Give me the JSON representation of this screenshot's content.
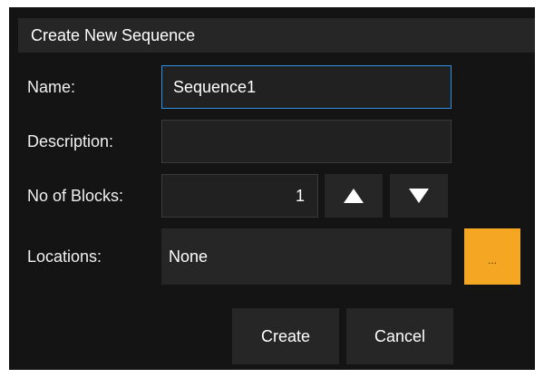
{
  "dialog": {
    "title": "Create New Sequence"
  },
  "form": {
    "name_label": "Name:",
    "name_value": "Sequence1",
    "description_label": "Description:",
    "description_value": "",
    "blocks_label": "No of Blocks:",
    "blocks_value": "1",
    "locations_label": "Locations:",
    "locations_value": "None",
    "browse_label": "..."
  },
  "actions": {
    "create_label": "Create",
    "cancel_label": "Cancel"
  },
  "colors": {
    "background": "#141414",
    "panel": "#262626",
    "accent": "#f5a623",
    "focus": "#2f8fe0"
  }
}
